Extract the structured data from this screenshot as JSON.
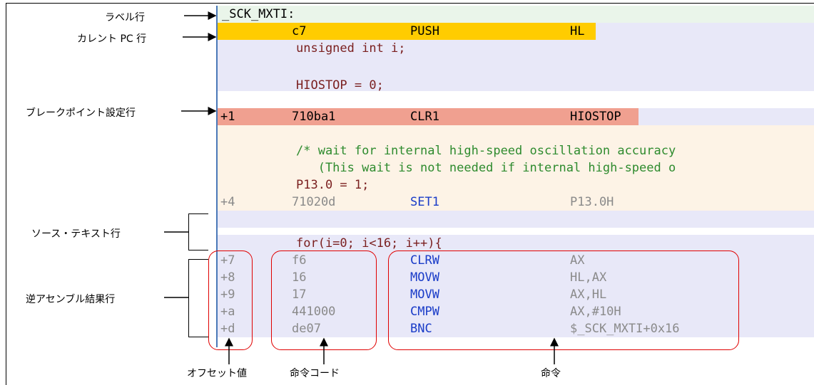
{
  "code": {
    "label_row": "_SCK_MXTI:",
    "pc_row": {
      "offset": "",
      "code": "c7",
      "mnemonic": "PUSH",
      "operand": "HL"
    },
    "src1": "unsigned int i;",
    "src2": "HIOSTOP = 0;",
    "bp_row": {
      "offset": "+1",
      "code": "710ba1",
      "mnemonic": "CLR1",
      "operand": "HIOSTOP"
    },
    "src3": "/* wait for internal high-speed oscillation accuracy",
    "src4": "   (This wait is not needed if internal high-speed o",
    "src5": "P13.0 = 1;",
    "row_set1": {
      "offset": "+4",
      "code": "71020d",
      "mnemonic": "SET1",
      "operand": "P13.0H"
    },
    "src6": "for(i=0; i<16; i++){",
    "asm_rows": [
      {
        "offset": "+7",
        "code": "f6",
        "mnemonic": "CLRW",
        "operand": "AX"
      },
      {
        "offset": "+8",
        "code": "16",
        "mnemonic": "MOVW",
        "operand": "HL,AX"
      },
      {
        "offset": "+9",
        "code": "17",
        "mnemonic": "MOVW",
        "operand": "AX,HL"
      },
      {
        "offset": "+a",
        "code": "441000",
        "mnemonic": "CMPW",
        "operand": "AX,#10H"
      },
      {
        "offset": "+d",
        "code": "de07",
        "mnemonic": "BNC",
        "operand": "$_SCK_MXTI+0x16"
      }
    ]
  },
  "annotations": {
    "label_row": "ラベル行",
    "current_pc": "カレント PC 行",
    "breakpoint": "ブレークポイント設定行",
    "source_text": "ソース・テキスト行",
    "disasm": "逆アセンブル結果行",
    "offset_value": "オフセット値",
    "inst_code": "命令コード",
    "instruction": "命令"
  }
}
